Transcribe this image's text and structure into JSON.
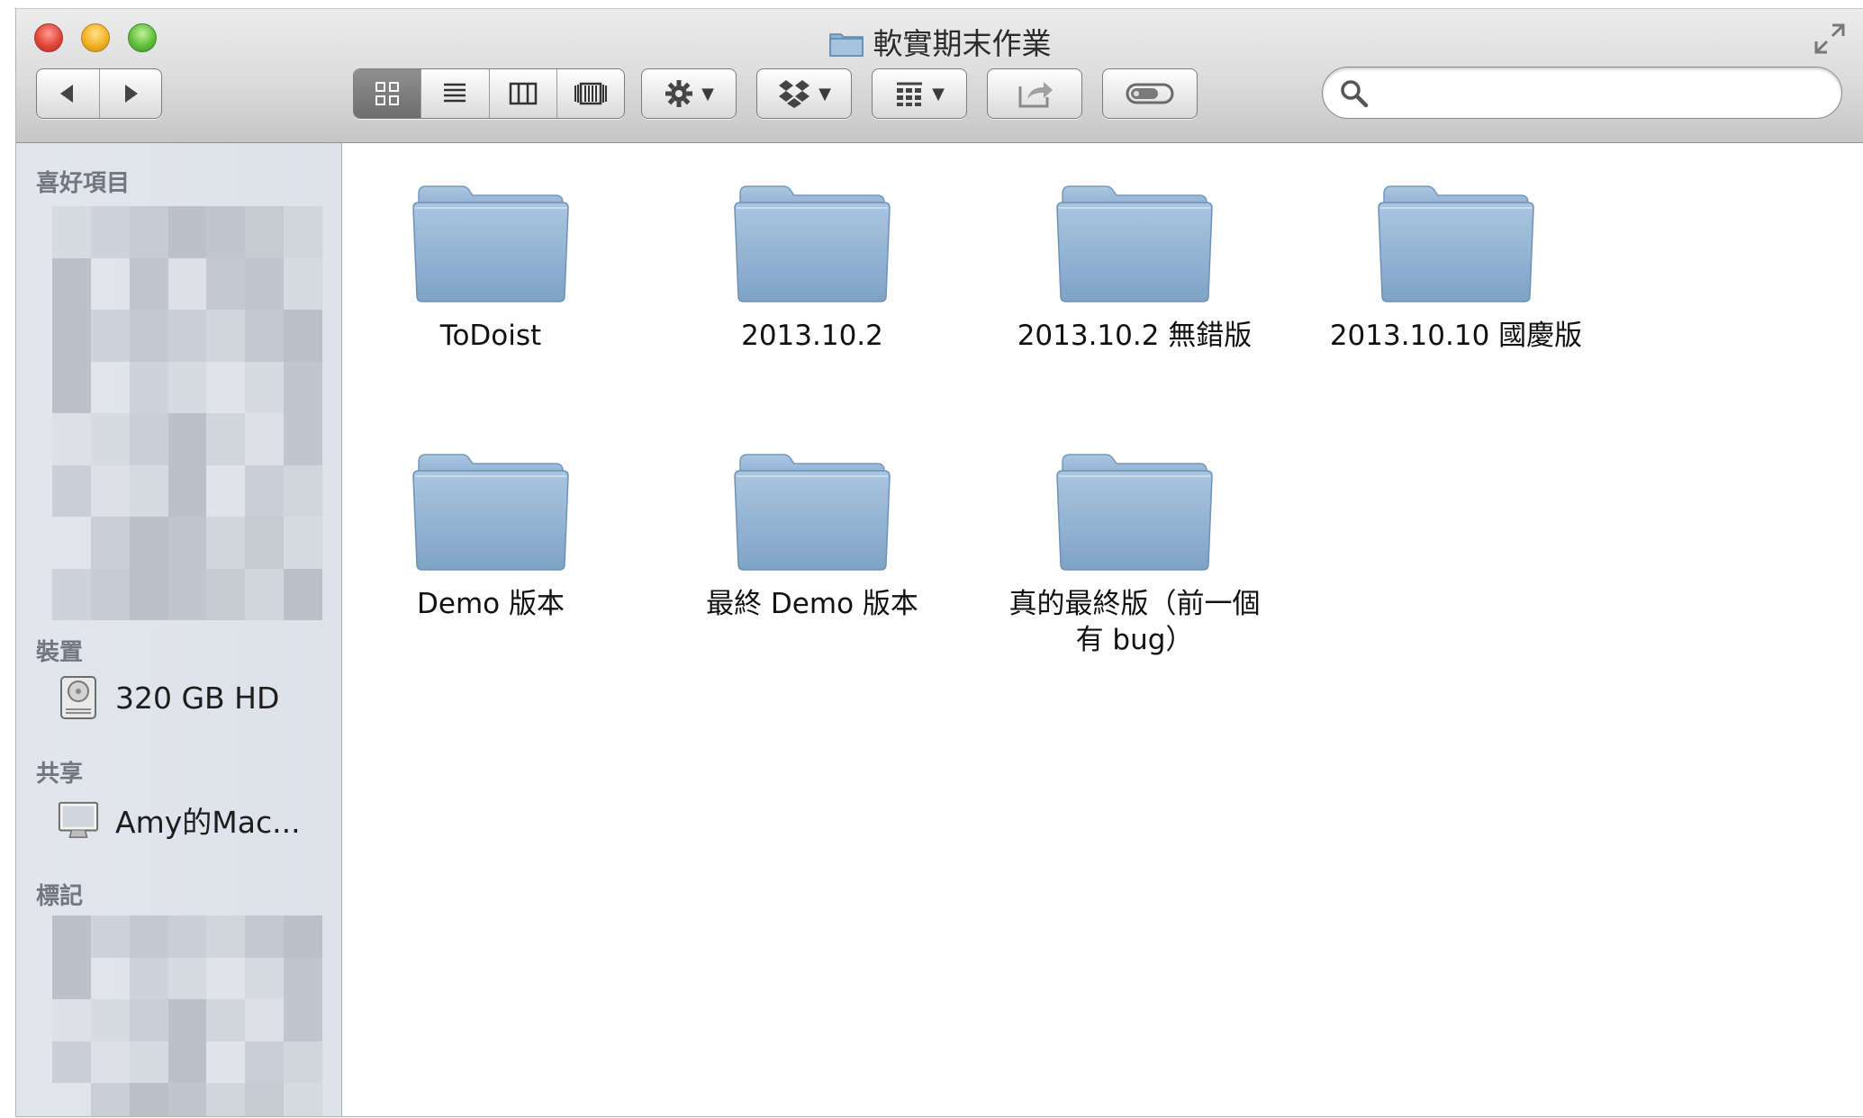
{
  "window": {
    "title": "軟實期末作業"
  },
  "toolbar": {
    "back": "back",
    "forward": "forward",
    "views": [
      "icon-view",
      "list-view",
      "column-view",
      "coverflow-view"
    ],
    "active_view": "icon-view",
    "action_menu": "gear-icon",
    "dropbox_menu": "dropbox-icon",
    "arrange_menu": "arrange-icon",
    "share_button": "share-icon",
    "tags_button": "tag-icon",
    "search": {
      "value": "",
      "placeholder": ""
    }
  },
  "sidebar": {
    "favorites_header": "喜好項目",
    "devices_header": "裝置",
    "devices": [
      {
        "label": "320 GB HD",
        "icon": "hard-drive-icon"
      }
    ],
    "shared_header": "共享",
    "shared": [
      {
        "label": "Amy的Mac...",
        "icon": "computer-icon"
      }
    ],
    "tags_header": "標記"
  },
  "files": [
    {
      "name": "ToDoist",
      "type": "folder"
    },
    {
      "name": "2013.10.2",
      "type": "folder"
    },
    {
      "name": "2013.10.2 無錯版",
      "type": "folder"
    },
    {
      "name": "2013.10.10 國慶版",
      "type": "folder"
    },
    {
      "name": "Demo 版本",
      "type": "folder"
    },
    {
      "name": "最終 Demo 版本",
      "type": "folder"
    },
    {
      "name": "真的最終版（前一個有 bug）",
      "type": "folder"
    }
  ],
  "colors": {
    "folder": "#8fb2d2",
    "sidebar_bg": "#e0e4ea",
    "titlebar_top": "#ececec",
    "titlebar_bottom": "#c6c6c6"
  }
}
